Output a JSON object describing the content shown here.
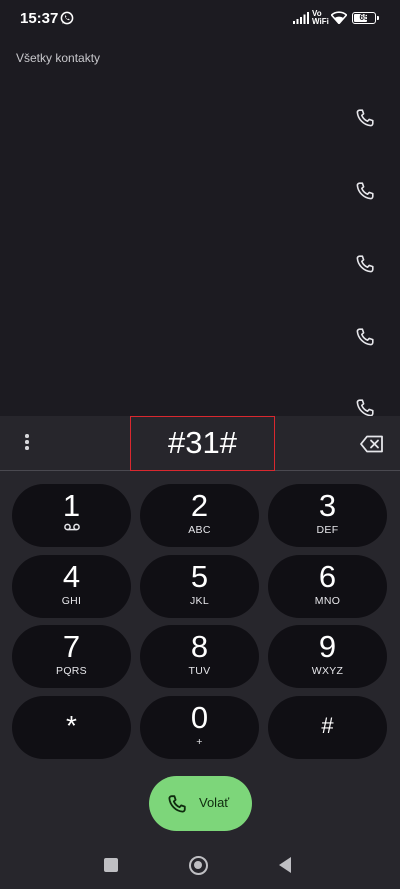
{
  "status_bar": {
    "time": "15:37",
    "vo": "Vo",
    "wifi": "WiFi",
    "battery": "65",
    "battery_level_percent": 65
  },
  "contacts": {
    "header": "Všetky kontakty",
    "call_icon_count": 5
  },
  "dialer": {
    "number": "#31#",
    "keys": [
      {
        "digit": "1",
        "sub": ""
      },
      {
        "digit": "2",
        "sub": "ABC"
      },
      {
        "digit": "3",
        "sub": "DEF"
      },
      {
        "digit": "4",
        "sub": "GHI"
      },
      {
        "digit": "5",
        "sub": "JKL"
      },
      {
        "digit": "6",
        "sub": "MNO"
      },
      {
        "digit": "7",
        "sub": "PQRS"
      },
      {
        "digit": "8",
        "sub": "TUV"
      },
      {
        "digit": "9",
        "sub": "WXYZ"
      },
      {
        "digit": "*",
        "sub": ""
      },
      {
        "digit": "0",
        "sub": "+"
      },
      {
        "digit": "#",
        "sub": ""
      }
    ],
    "call_label": "Volať"
  },
  "colors": {
    "background": "#1c1b21",
    "dial_panel": "#27262c",
    "key_background": "#100f14",
    "call_button": "#7dd67a",
    "highlight_box": "#d9282f"
  },
  "icons": [
    "whatsapp-icon",
    "signal-icon",
    "wifi-icon",
    "battery-icon",
    "phone-icon",
    "more-vert-icon",
    "backspace-icon",
    "voicemail-icon",
    "nav-recents-icon",
    "nav-home-icon",
    "nav-back-icon"
  ]
}
